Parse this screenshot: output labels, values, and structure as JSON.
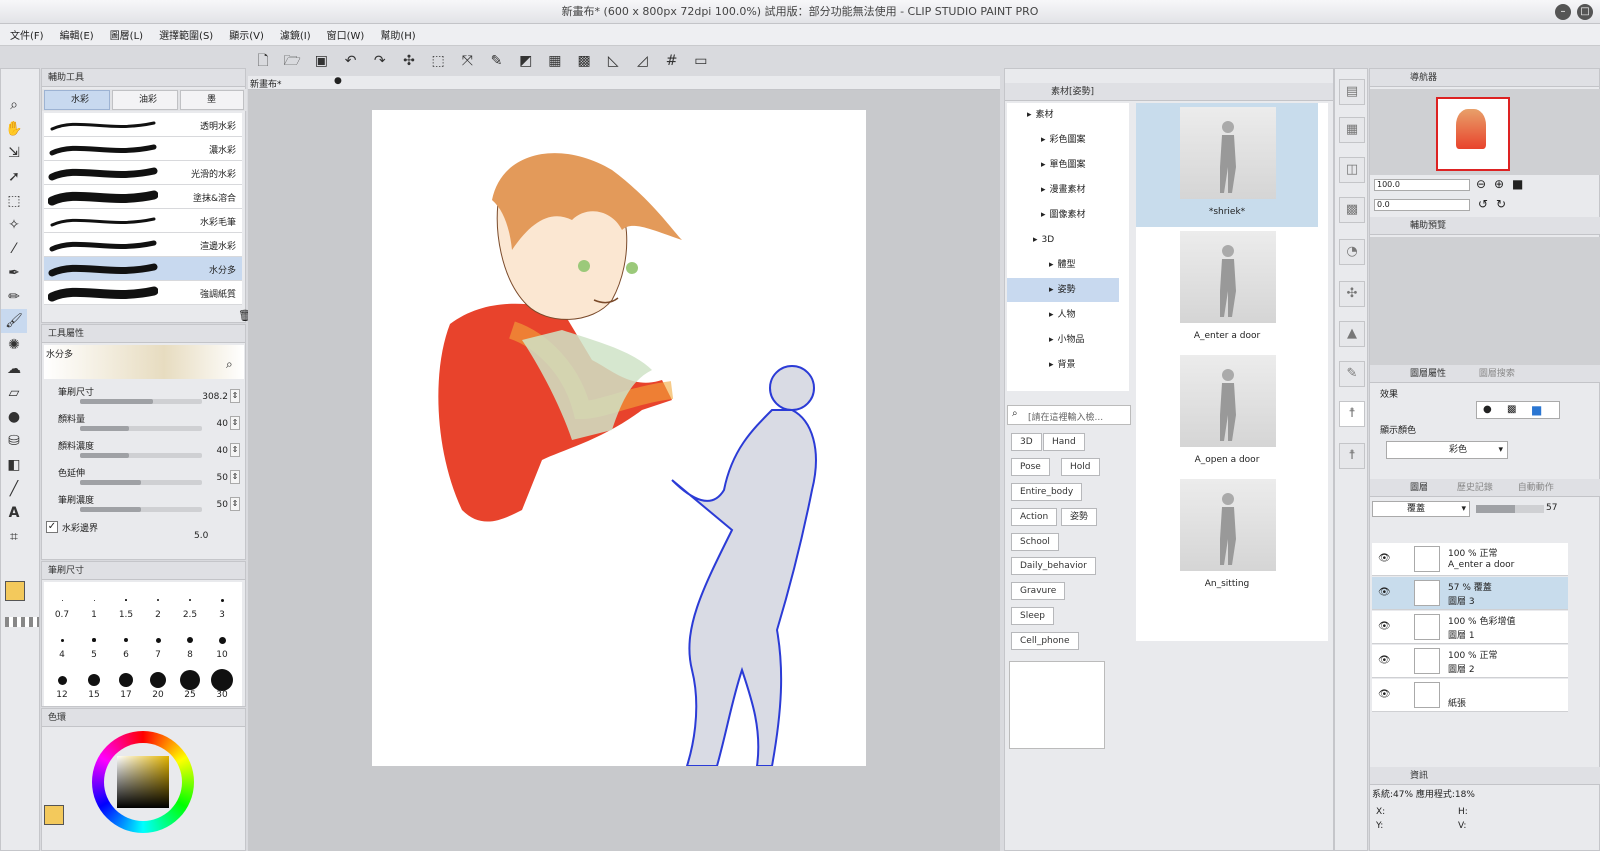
{
  "window": {
    "title": "新畫布* (600 x 800px 72dpi 100.0%)  試用版：部分功能無法使用 - CLIP STUDIO PAINT PRO"
  },
  "menu": [
    "文件(F)",
    "編輯(E)",
    "圖層(L)",
    "選擇範圍(S)",
    "顯示(V)",
    "濾鏡(I)",
    "窗口(W)",
    "幫助(H)"
  ],
  "canvas": {
    "tab": "新畫布*"
  },
  "sub_tool": {
    "header": "輔助工具",
    "tabs": [
      "水彩",
      "油彩",
      "墨"
    ],
    "brushes": [
      "透明水彩",
      "濃水彩",
      "光滑的水彩",
      "塗抹&溶合",
      "水彩毛筆",
      "渲邊水彩",
      "水分多",
      "強調紙質"
    ],
    "selected": "水分多"
  },
  "tool_property": {
    "header": "工具屬性",
    "name": "水分多",
    "props": [
      {
        "label": "筆刷尺寸",
        "value": "308.2",
        "level": 0.6
      },
      {
        "label": "顏料量",
        "value": "40",
        "level": 0.4
      },
      {
        "label": "顏料濃度",
        "value": "40",
        "level": 0.4
      },
      {
        "label": "色延伸",
        "value": "50",
        "level": 0.5
      },
      {
        "label": "筆刷濃度",
        "value": "50",
        "level": 0.5
      }
    ],
    "checkbox_label": "水彩邊界",
    "checkbox_value": "5.0"
  },
  "brush_size": {
    "header": "筆刷尺寸",
    "sizes": [
      "0.7",
      "1",
      "1.5",
      "2",
      "2.5",
      "3",
      "4",
      "5",
      "6",
      "7",
      "8",
      "10",
      "12",
      "15",
      "17",
      "20",
      "25",
      "30"
    ]
  },
  "color_wheel": {
    "header": "色環",
    "main_color": "#f3c95c"
  },
  "material": {
    "header": "素材[姿勢]",
    "tree": [
      "素材",
      "彩色圖案",
      "單色圖案",
      "漫畫素材",
      "圖像素材",
      "3D",
      "體型",
      "姿勢",
      "人物",
      "小物品",
      "背景"
    ],
    "search_placeholder": "[請在這裡輸入檢...",
    "tags": [
      "3D",
      "Hand",
      "Pose",
      "Hold",
      "Entire_body",
      "Action",
      "姿勢",
      "School",
      "Daily_behavior",
      "Gravure",
      "Sleep",
      "Cell_phone"
    ],
    "items": [
      "*shriek*",
      "A_enter a door",
      "A_open a door",
      "An_sitting"
    ]
  },
  "navigator": {
    "header": "導航器",
    "zoom": "100.0",
    "rotate": "0.0"
  },
  "sub_view": {
    "header": "輔助預覽"
  },
  "layer_property": {
    "header": "圖層屬性",
    "tab2": "圖層搜索",
    "effect_label": "效果",
    "display_color_label": "顯示顏色",
    "display_color_value": "彩色"
  },
  "layers": {
    "tabs": [
      "圖層",
      "歷史記錄",
      "自動動作"
    ],
    "blend": "覆蓋",
    "opacity": "57",
    "items": [
      {
        "t1": "100 %  正常",
        "t2": "A_enter a door"
      },
      {
        "t1": "57 %  覆蓋",
        "t2": "圖層 3"
      },
      {
        "t1": "100 %  色彩增值",
        "t2": "圖層 1"
      },
      {
        "t1": "100 %  正常",
        "t2": "圖層 2"
      },
      {
        "t1": "",
        "t2": "紙張"
      }
    ]
  },
  "info": {
    "header": "資訊",
    "text": "系統:47%   應用程式:18%",
    "x_label": "X:",
    "y_label": "Y:",
    "h_label": "H:",
    "v_label": "V:"
  }
}
